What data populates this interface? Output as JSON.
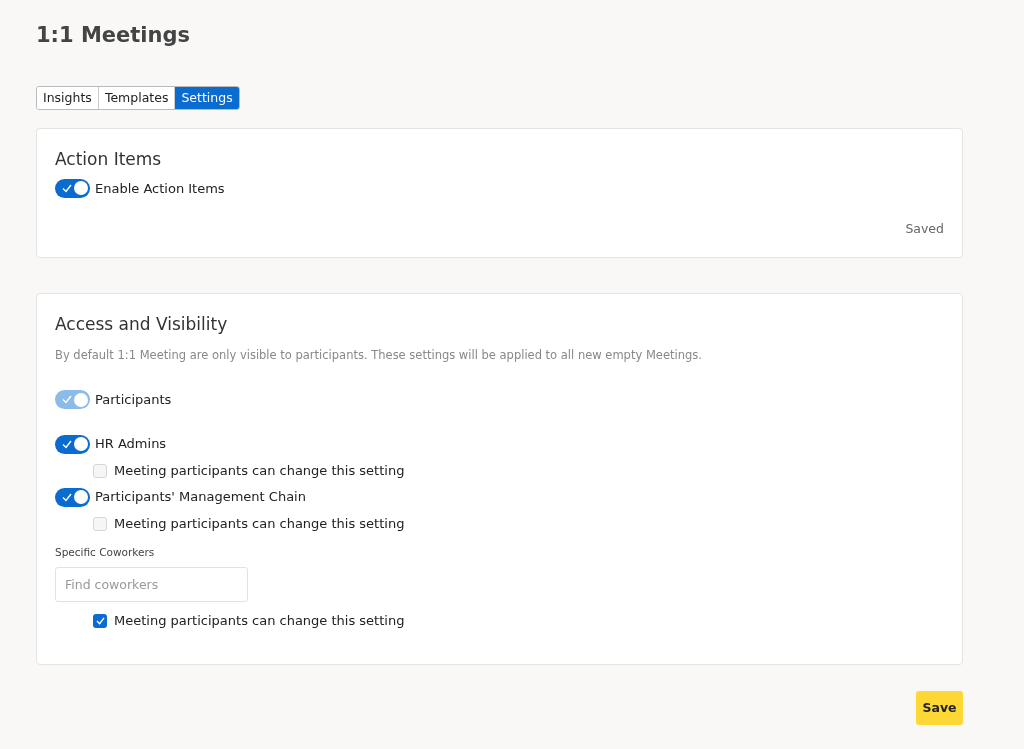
{
  "page_title": "1:1 Meetings",
  "tabs": [
    {
      "label": "Insights",
      "selected": false
    },
    {
      "label": "Templates",
      "selected": false
    },
    {
      "label": "Settings",
      "selected": true
    }
  ],
  "action_items": {
    "title": "Action Items",
    "toggle": {
      "label": "Enable Action Items",
      "on": true,
      "disabled": false
    },
    "status": "Saved"
  },
  "access": {
    "title": "Access and Visibility",
    "description": "By default 1:1 Meeting are only visible to participants. These settings will be applied to all new empty Meetings.",
    "rules": [
      {
        "label": "Participants",
        "on": true,
        "disabled": true
      },
      {
        "label": "HR Admins",
        "on": true,
        "disabled": false,
        "option": {
          "label": "Meeting participants can change this setting",
          "checked": false
        }
      },
      {
        "label": "Participants' Management Chain",
        "on": true,
        "disabled": false,
        "option": {
          "label": "Meeting participants can change this setting",
          "checked": false
        }
      }
    ],
    "coworkers": {
      "label": "Specific Coworkers",
      "placeholder": "Find coworkers",
      "option": {
        "label": "Meeting participants can change this setting",
        "checked": true
      }
    }
  },
  "save_button": "Save"
}
